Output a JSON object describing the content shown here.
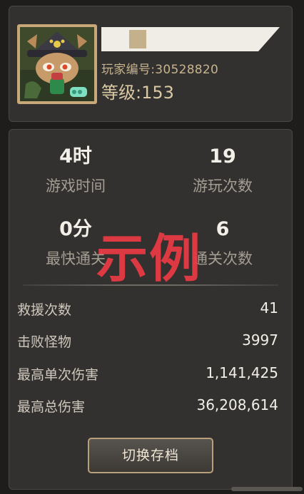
{
  "profile": {
    "player_id_label": "玩家编号:30528820",
    "level_label": "等级:153"
  },
  "summary": [
    {
      "value": "4时",
      "label": "游戏时间"
    },
    {
      "value": "19",
      "label": "游玩次数"
    },
    {
      "value": "0分",
      "label": "最快通关"
    },
    {
      "value": "6",
      "label": "通关次数"
    }
  ],
  "details": [
    {
      "label": "救援次数",
      "value": "41"
    },
    {
      "label": "击败怪物",
      "value": "3997"
    },
    {
      "label": "最高单次伤害",
      "value": "1,141,425"
    },
    {
      "label": "最高总伤害",
      "value": "36,208,614"
    }
  ],
  "actions": {
    "switch_save_label": "切换存档"
  },
  "watermark": "示例",
  "colors": {
    "watermark": "#eb3a44",
    "panel": "#33312f",
    "button_border": "#b9a07a"
  }
}
